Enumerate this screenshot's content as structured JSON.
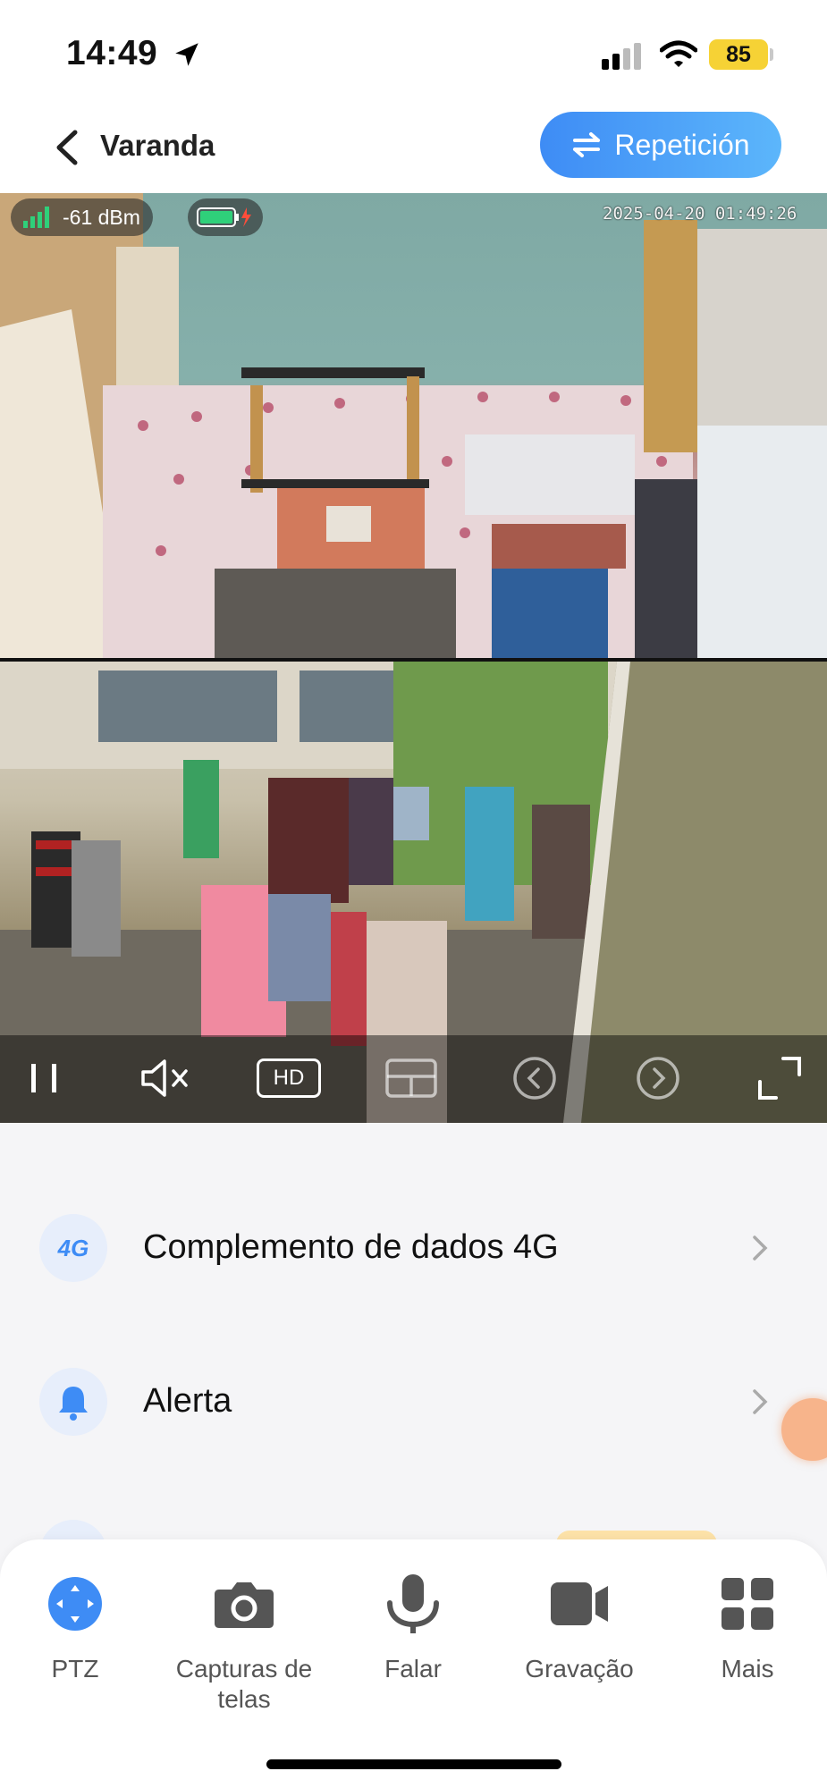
{
  "status_bar": {
    "time": "14:49",
    "battery": "85"
  },
  "header": {
    "title": "Varanda",
    "replay_label": "Repetición"
  },
  "video": {
    "signal_text": "-61 dBm",
    "timestamp": "2025-04-20 01:49:26",
    "controls": {
      "hd_label": "HD"
    }
  },
  "menu": {
    "items": [
      {
        "icon_text": "4G",
        "label": "Complemento de dados 4G"
      },
      {
        "label": "Alerta"
      }
    ]
  },
  "toolbar": {
    "items": [
      {
        "label": "PTZ",
        "icon": "ptz-icon"
      },
      {
        "label": "Capturas de telas",
        "icon": "camera-icon"
      },
      {
        "label": "Falar",
        "icon": "microphone-icon"
      },
      {
        "label": "Gravação",
        "icon": "video-record-icon"
      },
      {
        "label": "Mais",
        "icon": "grid-icon"
      }
    ]
  },
  "colors": {
    "accent": "#3e8cf5",
    "battery_badge": "#f6d235"
  }
}
